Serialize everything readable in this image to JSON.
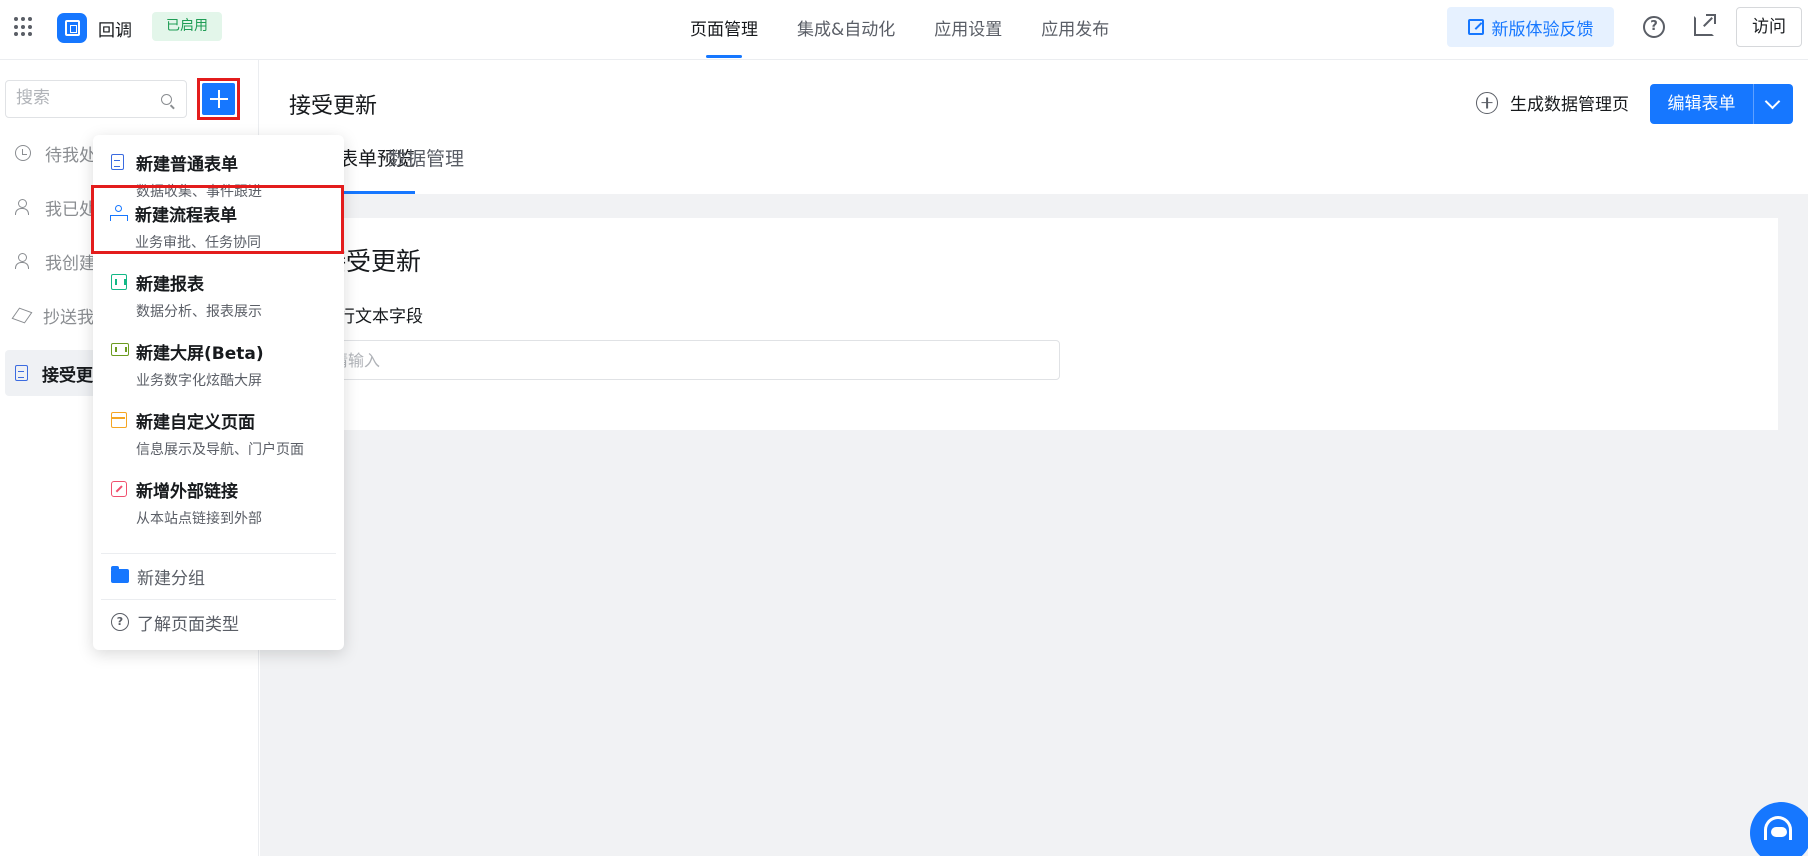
{
  "topbar": {
    "app_name": "回调",
    "status": "已启用",
    "nav": [
      "页面管理",
      "集成&自动化",
      "应用设置",
      "应用发布"
    ],
    "help_glyph": "?",
    "feedback_label": "新版体验反馈",
    "visit_label": "访问"
  },
  "sidebar": {
    "search_placeholder": "搜索",
    "items": [
      {
        "label": "待我处理"
      },
      {
        "label": "我已处理"
      },
      {
        "label": "我创建的"
      },
      {
        "label": "抄送我的"
      },
      {
        "label": "接受更新"
      }
    ]
  },
  "main": {
    "page_title": "接受更新",
    "gen_data_label": "生成数据管理页",
    "edit_form_label": "编辑表单",
    "tabs": [
      "表单预览",
      "数据管理"
    ],
    "card_title": "接受更新",
    "field_label": "单行文本字段",
    "field_placeholder": "请输入"
  },
  "popup": {
    "items": [
      {
        "title": "新建普通表单",
        "desc": "数据收集、事件跟进"
      },
      {
        "title": "新建流程表单",
        "desc": "业务审批、任务协同"
      },
      {
        "title": "新建报表",
        "desc": "数据分析、报表展示"
      },
      {
        "title": "新建大屏(Beta)",
        "desc": "业务数字化炫酷大屏"
      },
      {
        "title": "新建自定义页面",
        "desc": "信息展示及导航、门户页面"
      },
      {
        "title": "新增外部链接",
        "desc": "从本站点链接到外部"
      }
    ],
    "new_group": "新建分组",
    "learn_types": "了解页面类型",
    "help_glyph": "?"
  },
  "colors": {
    "brand": "#1677ff",
    "highlight": "#e31c1c",
    "status_green": "#1f9d55"
  }
}
